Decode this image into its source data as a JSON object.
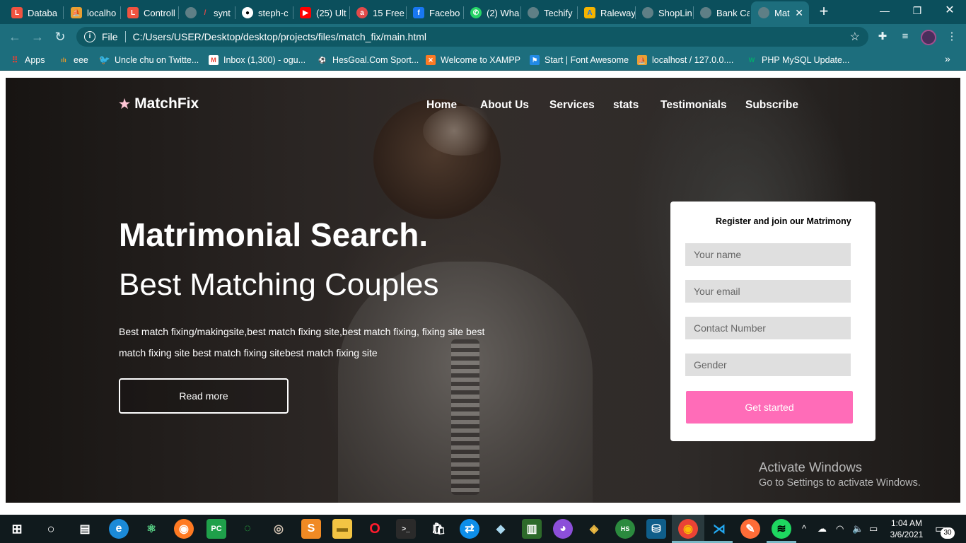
{
  "browser": {
    "tabs": [
      {
        "label": "Databa",
        "icon": "laravel-icon",
        "color": "#f05340"
      },
      {
        "label": "localho",
        "icon": "phpmyadmin-icon",
        "color": "#e9a032"
      },
      {
        "label": "Controll",
        "icon": "laravel-icon",
        "color": "#f05340"
      },
      {
        "label": "synt",
        "icon": "globe-icon",
        "color": "#8fa6ab"
      },
      {
        "label": "steph-c",
        "icon": "github-icon",
        "color": "#ffffff"
      },
      {
        "label": "(25) Ult",
        "icon": "youtube-icon",
        "color": "#ff0000"
      },
      {
        "label": "15 Free",
        "icon": "red-circle-icon",
        "color": "#e24a4a"
      },
      {
        "label": "Facebo",
        "icon": "facebook-icon",
        "color": "#1877f2"
      },
      {
        "label": "(2) Wha",
        "icon": "whatsapp-icon",
        "color": "#25d366"
      },
      {
        "label": "Techify",
        "icon": "globe-icon",
        "color": "#8fa6ab"
      },
      {
        "label": "Raleway",
        "icon": "google-fonts-icon",
        "color": "#f4b400"
      },
      {
        "label": "ShopLin",
        "icon": "globe-icon",
        "color": "#8fa6ab"
      },
      {
        "label": "Bank Ca",
        "icon": "globe-icon",
        "color": "#8fa6ab"
      },
      {
        "label": "Mat",
        "icon": "globe-icon",
        "color": "#8fa6ab",
        "active": true
      }
    ],
    "url_scheme": "File",
    "url": "C:/Users/USER/Desktop/desktop/projects/files/match_fix/main.html",
    "bookmarks": [
      {
        "label": "Apps",
        "icon": "apps-grid-icon",
        "color": "#e94235"
      },
      {
        "label": "eee",
        "icon": "bookmark-icon",
        "color": "#e89a2a"
      },
      {
        "label": "Uncle chu on Twitte...",
        "icon": "twitter-icon",
        "color": "#1da1f2"
      },
      {
        "label": "Inbox (1,300) - ogu...",
        "icon": "gmail-icon",
        "color": "#ea4335"
      },
      {
        "label": "HesGoal.Com Sport...",
        "icon": "hesgoal-icon",
        "color": "#ffffff"
      },
      {
        "label": "Welcome to XAMPP",
        "icon": "xampp-icon",
        "color": "#fb7a24"
      },
      {
        "label": "Start | Font Awesome",
        "icon": "flag-icon",
        "color": "#228ae6"
      },
      {
        "label": "localhost / 127.0.0....",
        "icon": "phpmyadmin-icon",
        "color": "#e9a032"
      },
      {
        "label": "PHP MySQL Update...",
        "icon": "w3schools-icon",
        "color": "#04aa6d"
      }
    ]
  },
  "page": {
    "logo_text": "MatchFix",
    "nav": [
      "Home",
      "About Us",
      "Services",
      "stats",
      "Testimonials",
      "Subscribe"
    ],
    "headline": "Matrimonial Search.",
    "subheadline": "Best Matching Couples",
    "description": "Best match fixing/makingsite,best match fixing site,best match fixing, fixing site best match fixing site best match fixing sitebest match fixing site",
    "read_more": "Read more",
    "form": {
      "title": "Register and join our Matrimony",
      "fields": [
        "Your name",
        "Your email",
        "Contact Number",
        "Gender"
      ],
      "submit": "Get started"
    },
    "accent_color": "#ff6cb8"
  },
  "watermark": {
    "line1": "Activate Windows",
    "line2": "Go to Settings to activate Windows."
  },
  "taskbar": {
    "time": "1:04 AM",
    "date": "3/6/2021",
    "notification_count": "30"
  }
}
